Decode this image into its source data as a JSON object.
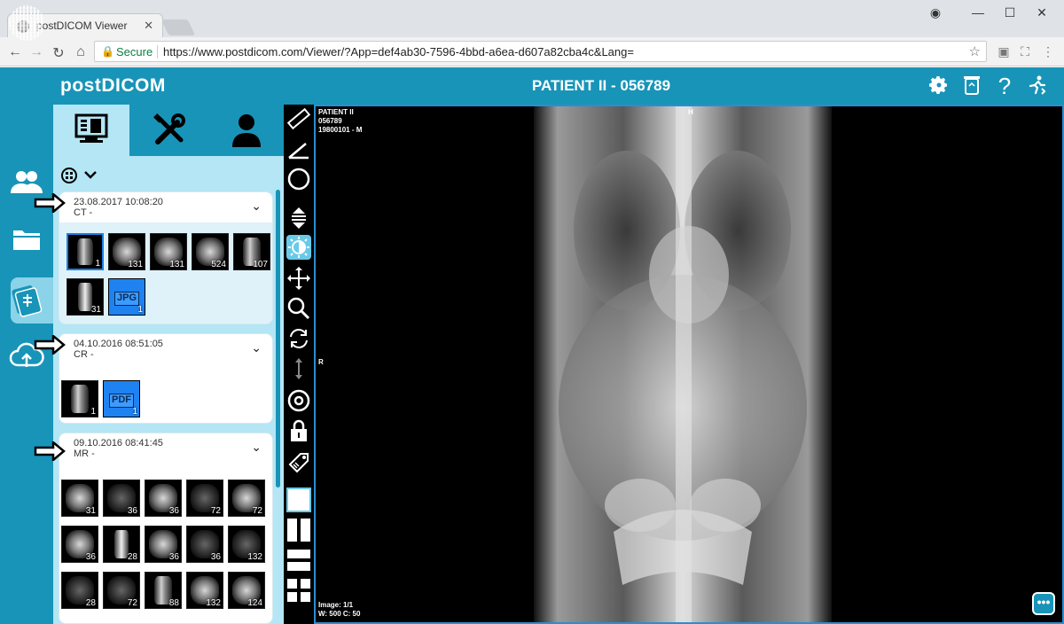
{
  "browser": {
    "tab_title": "postDICOM Viewer",
    "secure_label": "Secure",
    "url": "https://www.postdicom.com/Viewer/?App=def4ab30-7596-4bbd-a6ea-d607a82cba4c&Lang="
  },
  "app": {
    "logo": "postDICOM",
    "patient_title": "PATIENT II - 056789",
    "header_icons": [
      "gear-icon",
      "trash-icon",
      "help-icon",
      "exit-icon"
    ]
  },
  "rail": [
    "patients-icon",
    "folder-icon",
    "studies-icon",
    "cloud-upload-icon"
  ],
  "panel_tabs": [
    "viewer-tab",
    "tools-tab",
    "patient-tab"
  ],
  "studies": [
    {
      "date": "23.08.2017 10:08:20",
      "modality": "CT -",
      "thumbs": [
        {
          "count": "1",
          "kind": "body",
          "selected": true
        },
        {
          "count": "131",
          "kind": "round"
        },
        {
          "count": "131",
          "kind": "round"
        },
        {
          "count": "524",
          "kind": "round"
        },
        {
          "count": "107",
          "kind": "body"
        },
        {
          "count": "31",
          "kind": "spine"
        },
        {
          "count": "1",
          "kind": "doc",
          "label": "JPG"
        }
      ]
    },
    {
      "date": "04.10.2016 08:51:05",
      "modality": "CR -",
      "thumbs": [
        {
          "count": "1",
          "kind": "round"
        },
        {
          "count": "1",
          "kind": "doc",
          "label": "PDF"
        }
      ]
    },
    {
      "date": "09.10.2016 08:41:45",
      "modality": "MR -",
      "thumbs": [
        {
          "count": "31",
          "kind": "round"
        },
        {
          "count": "36",
          "kind": "dark"
        },
        {
          "count": "36",
          "kind": "round"
        },
        {
          "count": "72",
          "kind": "dark"
        },
        {
          "count": "72",
          "kind": "round"
        },
        {
          "count": "36",
          "kind": "round"
        },
        {
          "count": "28",
          "kind": "spine"
        },
        {
          "count": "36",
          "kind": "round"
        },
        {
          "count": "36",
          "kind": "dark"
        },
        {
          "count": "132",
          "kind": "dark"
        },
        {
          "count": "28",
          "kind": "dark"
        },
        {
          "count": "72",
          "kind": "dark"
        },
        {
          "count": "88",
          "kind": "body"
        },
        {
          "count": "132",
          "kind": "round"
        },
        {
          "count": "124",
          "kind": "round"
        }
      ]
    }
  ],
  "tools": [
    "ruler-icon",
    "angle-icon",
    "ellipse-icon",
    "stack-scroll-icon",
    "window-level-icon",
    "pan-icon",
    "zoom-icon",
    "rotate-icon",
    "flip-icon",
    "settings-icon",
    "lock-icon",
    "tag-icon",
    "layout-1x1-icon",
    "layout-1x2-icon",
    "layout-2x1-icon",
    "layout-2x2-icon"
  ],
  "viewer": {
    "overlay_lines": [
      "PATIENT II",
      "056789",
      "19800101 - M"
    ],
    "orientation_top": "H",
    "orientation_left": "R",
    "image_label": "Image: 1/1",
    "wl_label": "W: 500 C: 50",
    "more_button": "•••"
  }
}
